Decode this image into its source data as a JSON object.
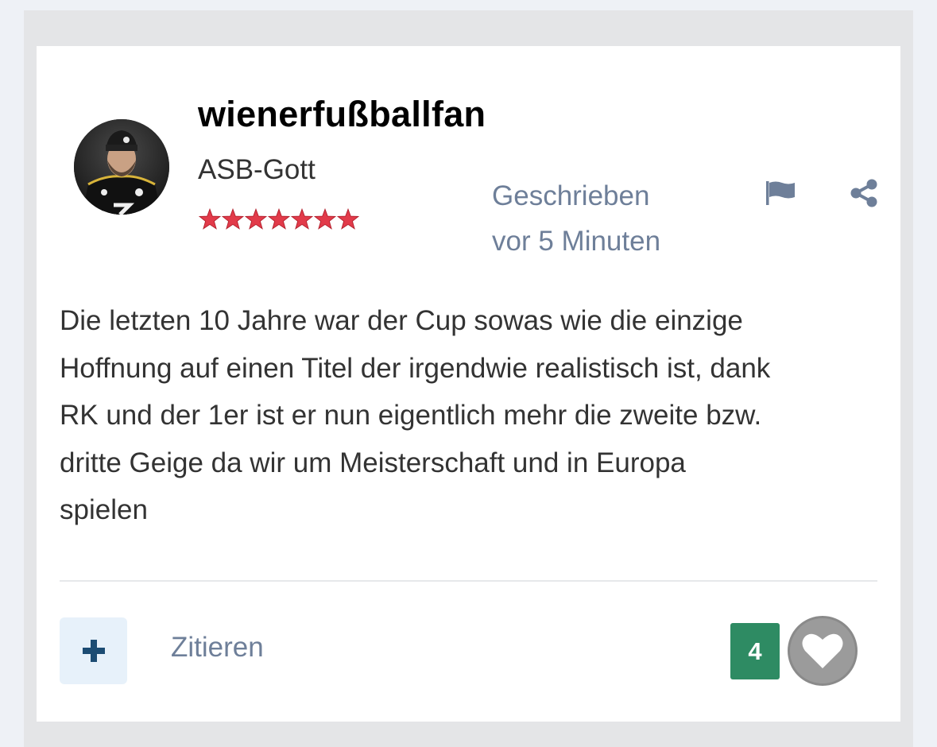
{
  "post": {
    "author": {
      "name": "wienerfußballfan",
      "rank": "ASB-Gott",
      "stars": 7,
      "star_color": "#e23b4a"
    },
    "meta": {
      "line1": "Geschrieben",
      "line2": "vor 5 Minuten"
    },
    "body": [
      "Die letzten 10 Jahre war der Cup sowas wie die einzige",
      "Hoffnung auf einen Titel der irgendwie realistisch ist, dank",
      "RK und der 1er ist er nun eigentlich mehr die zweite bzw.",
      "dritte Geige da wir um Meisterschaft und in Europa",
      "spielen"
    ],
    "actions": {
      "multiquote_icon": "plus-icon",
      "quote_label": "Zitieren",
      "reaction_count": "4",
      "reaction_icon": "heart-icon",
      "report_icon": "flag-icon",
      "share_icon": "share-icon"
    },
    "colors": {
      "accent": "#6e7f99",
      "reaction_badge": "#2e8b63",
      "multiquote_bg": "#e7f1fa",
      "multiquote_icon": "#1c4c73"
    }
  }
}
